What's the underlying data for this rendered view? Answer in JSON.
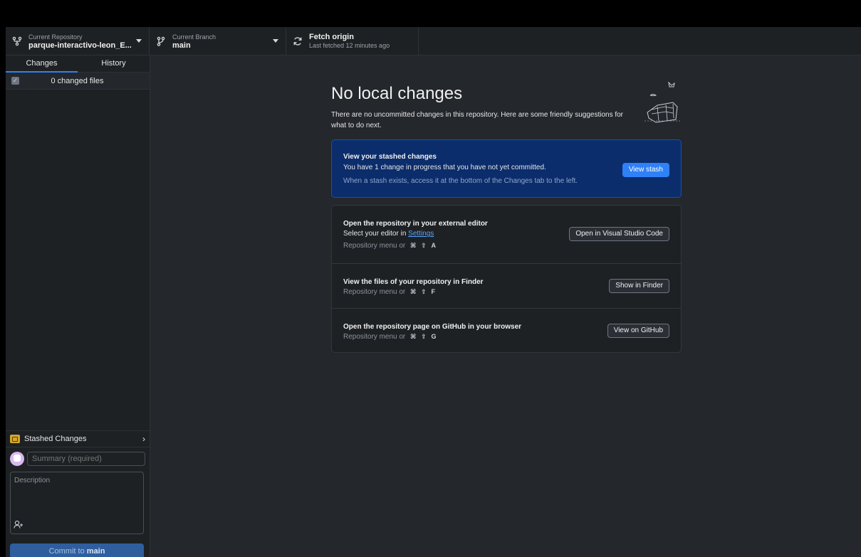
{
  "toolbar": {
    "repo_caption": "Current Repository",
    "repo_name": "parque-interactivo-leon_E...",
    "branch_caption": "Current Branch",
    "branch_name": "main",
    "fetch_title": "Fetch origin",
    "fetch_subtitle": "Last fetched 12 minutes ago"
  },
  "sidebar": {
    "tabs": [
      {
        "label": "Changes",
        "active": true
      },
      {
        "label": "History",
        "active": false
      }
    ],
    "changes_count": "0 changed files",
    "stashed_label": "Stashed Changes",
    "summary_placeholder": "Summary (required)",
    "description_placeholder": "Description",
    "commit_prefix": "Commit to",
    "commit_branch": "main"
  },
  "main": {
    "title": "No local changes",
    "subtitle": "There are no uncommitted changes in this repository. Here are some friendly suggestions for what to do next.",
    "stash_card": {
      "title": "View your stashed changes",
      "text": "You have 1 change in progress that you have not yet committed.",
      "muted": "When a stash exists, access it at the bottom of the Changes tab to the left.",
      "button": "View stash"
    },
    "options": [
      {
        "title": "Open the repository in your external editor",
        "text_prefix": "Select your editor in",
        "link": "Settings",
        "shortcut_prefix": "Repository menu or",
        "keys": [
          "⌘",
          "⇧",
          "A"
        ],
        "button": "Open in Visual Studio Code"
      },
      {
        "title": "View the files of your repository in Finder",
        "shortcut_prefix": "Repository menu or",
        "keys": [
          "⌘",
          "⇧",
          "F"
        ],
        "button": "Show in Finder"
      },
      {
        "title": "Open the repository page on GitHub in your browser",
        "shortcut_prefix": "Repository menu or",
        "keys": [
          "⌘",
          "⇧",
          "G"
        ],
        "button": "View on GitHub"
      }
    ]
  },
  "colors": {
    "accent": "#2f81f7",
    "stash_card_bg": "#0c2d6b",
    "sidebar_bg": "#1e2124",
    "main_bg": "#24272c"
  }
}
